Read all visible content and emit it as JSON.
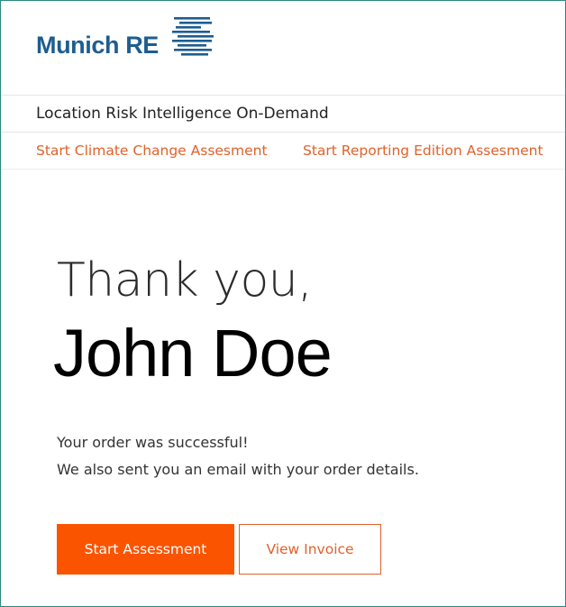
{
  "header": {
    "logo_text": "Munich RE"
  },
  "app": {
    "title": "Location Risk Intelligence On-Demand"
  },
  "nav": {
    "items": [
      {
        "label": "Start Climate Change Assesment"
      },
      {
        "label": "Start Reporting Edition Assesment"
      }
    ]
  },
  "main": {
    "thanks": "Thank you,",
    "name": "John Doe",
    "message_line1": "Your order was successful!",
    "message_line2": "We also sent you an email with your order details."
  },
  "actions": {
    "start_label": "Start Assessment",
    "invoice_label": "View Invoice"
  },
  "colors": {
    "brand_blue": "#1e5d8f",
    "accent_orange": "#fa5400",
    "link_orange": "#e0622b"
  },
  "icons": {
    "logo_mark": "munich-re-logo-mark-icon"
  }
}
